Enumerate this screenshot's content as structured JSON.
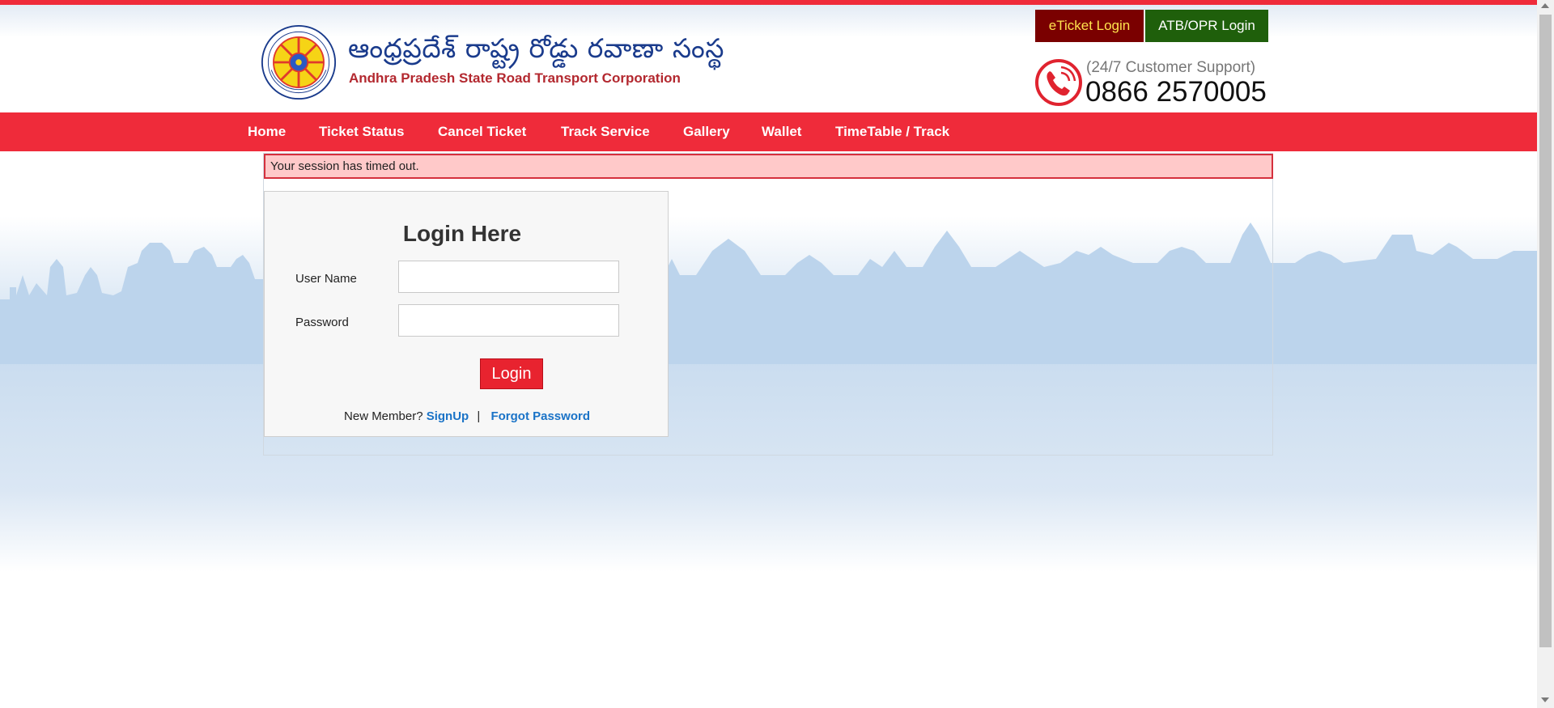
{
  "brand": {
    "telugu_name": "ఆంధ్రప్రదేశ్ రాష్ట్ర రోడ్డు రవాణా సంస్థ",
    "english_name": "Andhra Pradesh State Road Transport Corporation",
    "emblem_text": "APSRTC",
    "colors": {
      "red": "#ef2b3a",
      "navy": "#1a3b8c",
      "maroon": "#b3282f"
    }
  },
  "header": {
    "eticket_login": "eTicket Login",
    "atb_opr_login": "ATB/OPR Login",
    "support_label": "(24/7 Customer Support)",
    "support_number": "0866 2570005"
  },
  "nav": {
    "items": [
      "Home",
      "Ticket Status",
      "Cancel Ticket",
      "Track Service",
      "Gallery",
      "Wallet",
      "TimeTable / Track"
    ]
  },
  "alert": {
    "message": "Your session has timed out."
  },
  "login": {
    "title": "Login Here",
    "username_label": "User Name",
    "username_value": "",
    "password_label": "Password",
    "password_value": "",
    "submit_label": "Login",
    "new_member_text": "New Member?",
    "signup_link": "SignUp",
    "separator": "|",
    "forgot_link": "Forgot Password"
  }
}
